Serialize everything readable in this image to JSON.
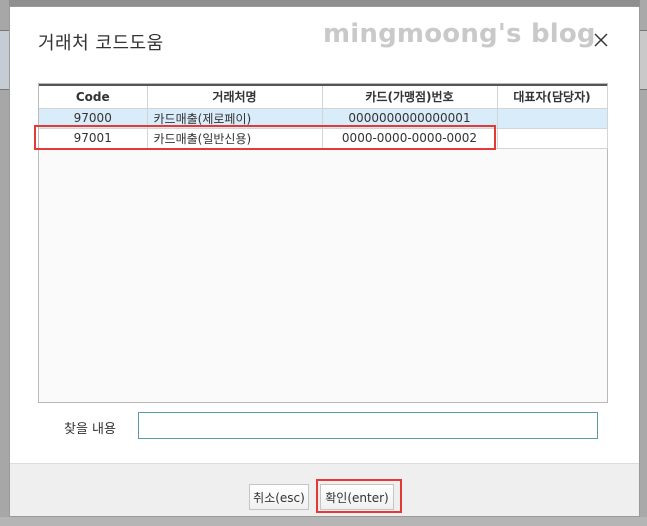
{
  "dialog": {
    "title": "거래처 코드도움",
    "watermark": "mingmoong's blog"
  },
  "grid": {
    "columns": [
      "Code",
      "거래처명",
      "카드(가맹점)번호",
      "대표자(담당자)"
    ],
    "rows": [
      {
        "code": "97000",
        "name": "카드매출(제로페이)",
        "card": "0000000000000001",
        "rep": ""
      },
      {
        "code": "97001",
        "name": "카드매출(일반신용)",
        "card": "0000-0000-0000-0002",
        "rep": ""
      }
    ],
    "selected_row": 0,
    "highlighted_row": 1
  },
  "search": {
    "label": "찾을 내용",
    "value": ""
  },
  "buttons": {
    "cancel_label": "취소(esc)",
    "ok_label": "확인(enter)"
  },
  "colors": {
    "selected_row": "#d9ecfa",
    "highlight": "#e53935",
    "input_border": "#5c9aa0"
  }
}
